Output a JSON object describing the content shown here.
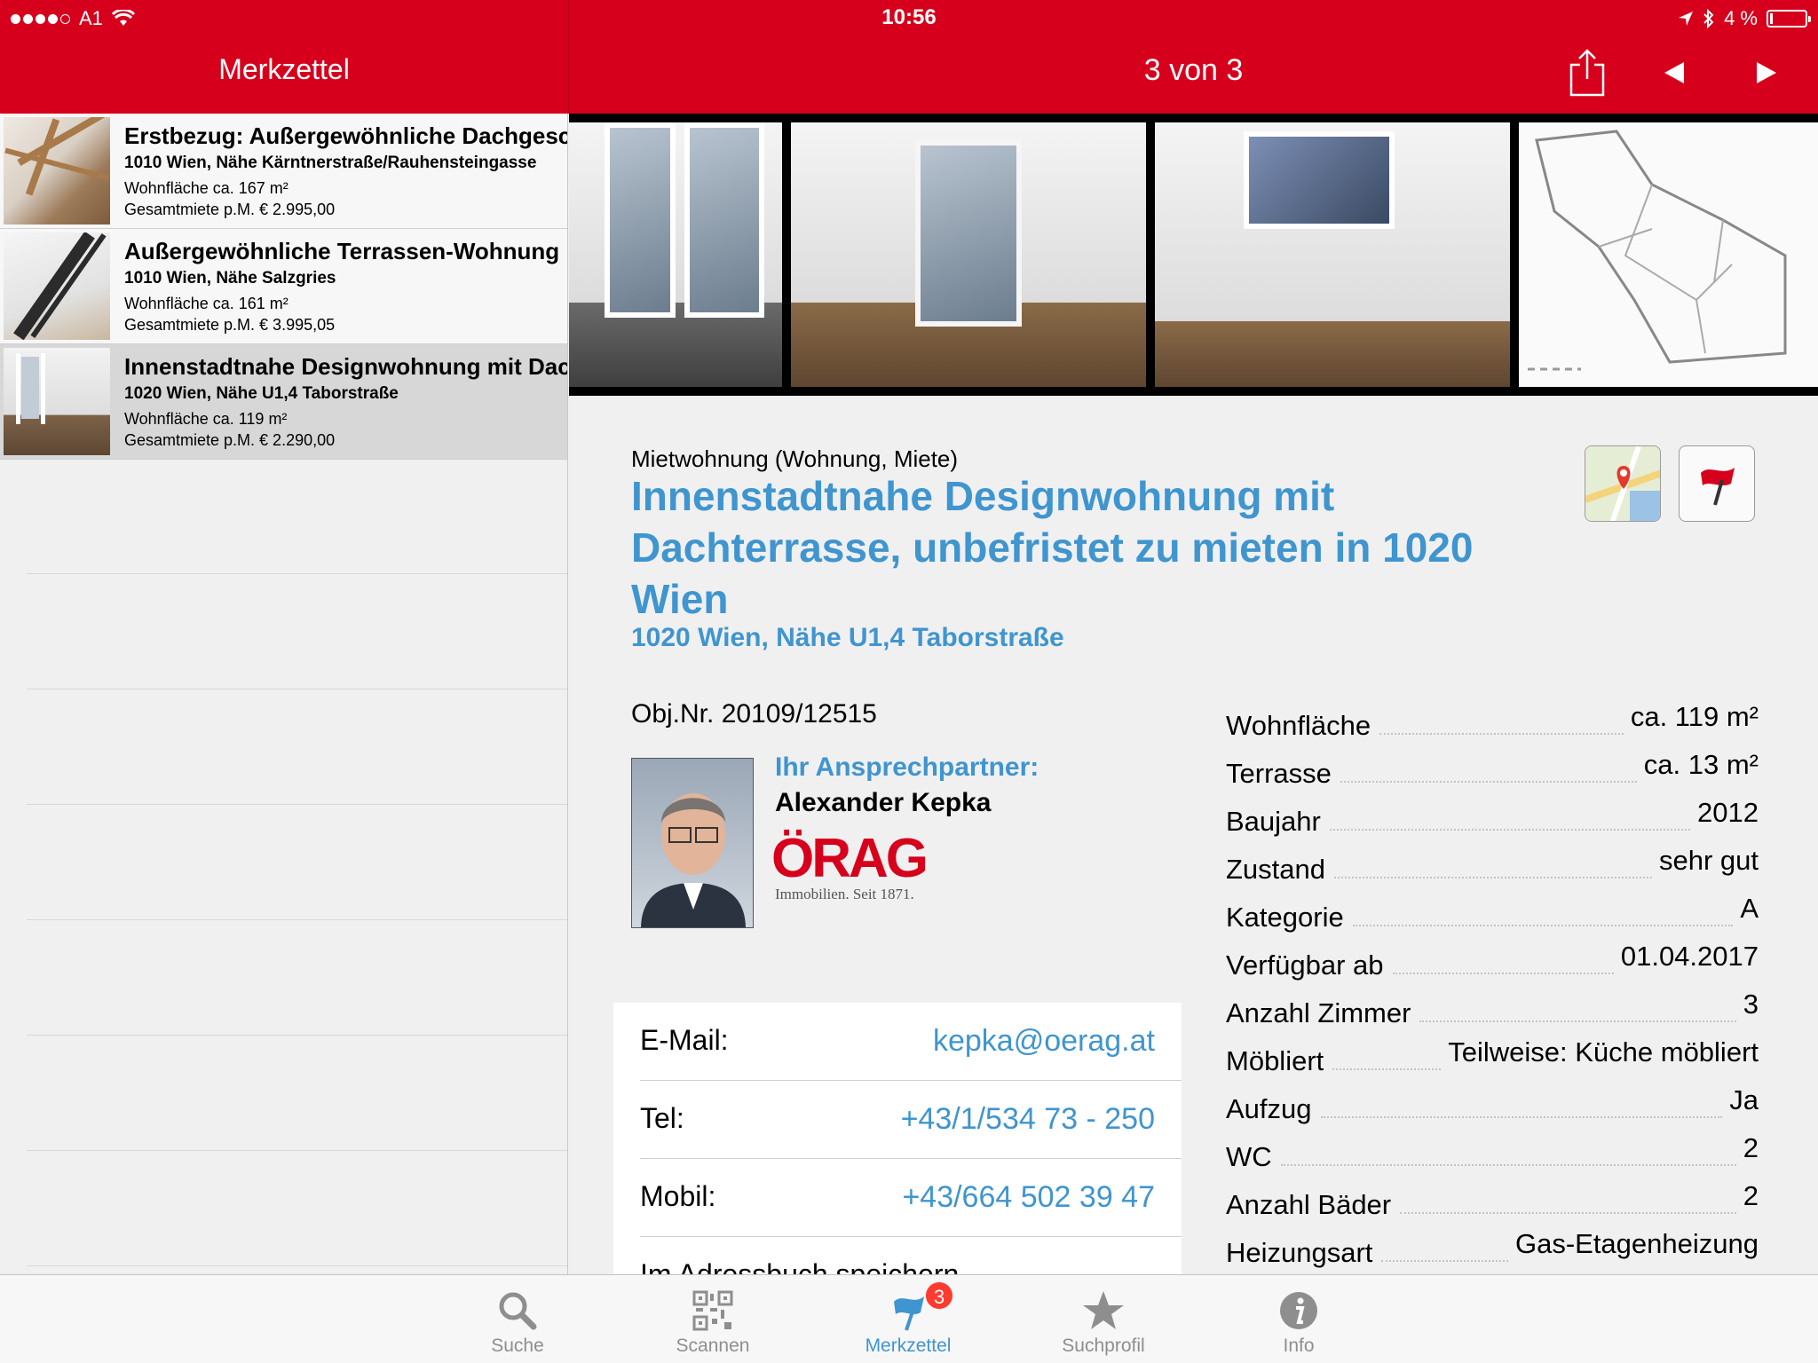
{
  "status_bar": {
    "carrier": "A1",
    "time": "10:56",
    "battery": "4 %"
  },
  "left_nav": {
    "title": "Merkzettel"
  },
  "right_nav": {
    "title": "3 von 3"
  },
  "list": [
    {
      "title": "Erstbezug: Außergewöhnliche Dachgeschoss",
      "address": "1010 Wien, Nähe Kärntnerstraße/Rauhensteingasse",
      "area": "Wohnfläche ca. 167 m²",
      "price": "Gesamtmiete p.M.  € 2.995,00"
    },
    {
      "title": "Außergewöhnliche Terrassen-Wohnung",
      "address": "1010 Wien, Nähe Salzgries",
      "area": "Wohnfläche ca. 161 m²",
      "price": "Gesamtmiete p.M.  € 3.995,05"
    },
    {
      "title": "Innenstadtnahe Designwohnung mit Dachterrasse",
      "address": "1020 Wien, Nähe U1,4 Taborstraße",
      "area": "Wohnfläche ca. 119 m²",
      "price": "Gesamtmiete p.M.  € 2.290,00"
    }
  ],
  "detail": {
    "category": "Mietwohnung (Wohnung, Miete)",
    "title": "Innenstadtnahe Designwohnung mit Dachterrasse, unbefristet zu mieten in 1020 Wien",
    "address": "1020 Wien, Nähe U1,4 Taborstraße",
    "object_number": "Obj.Nr. 20109/12515",
    "contact_heading": "Ihr Ansprechpartner:",
    "agent_name": "Alexander Kepka",
    "logo_text": "ÖRAG",
    "logo_tagline": "Immobilien. Seit 1871.",
    "contact": [
      {
        "label": "E-Mail:",
        "value": "kepka@oerag.at"
      },
      {
        "label": "Tel:",
        "value": "+43/1/534 73 - 250"
      },
      {
        "label": "Mobil:",
        "value": "+43/664 502 39 47"
      }
    ],
    "address_book": "Im Adressbuch speichern",
    "facts": [
      {
        "label": "Wohnfläche",
        "value": "ca. 119 m²"
      },
      {
        "label": "Terrasse",
        "value": "ca. 13 m²"
      },
      {
        "label": "Baujahr",
        "value": "2012"
      },
      {
        "label": "Zustand",
        "value": "sehr gut"
      },
      {
        "label": "Kategorie",
        "value": "A"
      },
      {
        "label": "Verfügbar ab",
        "value": "01.04.2017"
      },
      {
        "label": "Anzahl Zimmer",
        "value": "3"
      },
      {
        "label": "Möbliert",
        "value": "Teilweise: Küche möbliert"
      },
      {
        "label": "Aufzug",
        "value": "Ja"
      },
      {
        "label": "WC",
        "value": "2"
      },
      {
        "label": "Anzahl Bäder",
        "value": "2"
      },
      {
        "label": "Heizungsart",
        "value": "Gas-Etagenheizung"
      }
    ]
  },
  "tabs": [
    {
      "label": "Suche",
      "icon": "search-icon"
    },
    {
      "label": "Scannen",
      "icon": "qr-code-icon"
    },
    {
      "label": "Merkzettel",
      "icon": "flag-icon",
      "badge": "3",
      "active": true
    },
    {
      "label": "Suchprofil",
      "icon": "star-icon"
    },
    {
      "label": "Info",
      "icon": "info-icon"
    }
  ],
  "colors": {
    "brand_red": "#d6001c",
    "accent_blue": "#3f95cf",
    "badge_red": "#ff3b30"
  }
}
